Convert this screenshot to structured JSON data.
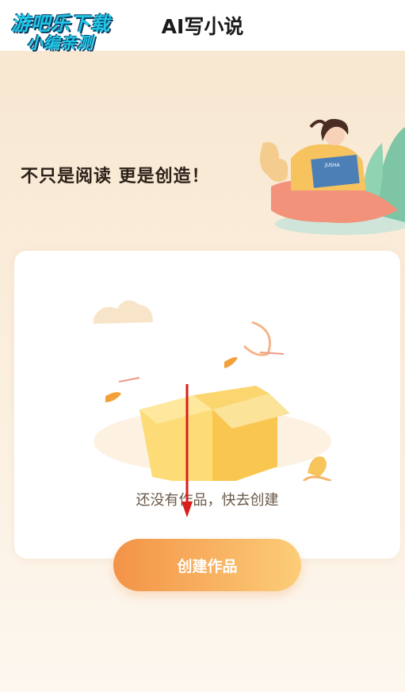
{
  "header": {
    "title": "AI写小说"
  },
  "watermark": {
    "line1": "游吧乐下载",
    "line2": "小编亲测"
  },
  "banner": {
    "slogan": "不只是阅读  更是创造！",
    "book_text": "JUSHA"
  },
  "empty_state": {
    "message": "还没有作品，快去创建"
  },
  "actions": {
    "create_label": "创建作品"
  },
  "colors": {
    "button_start": "#f39347",
    "button_end": "#fccd78",
    "accent_orange": "#f2a13a",
    "arrow_red": "#d91c1c"
  }
}
